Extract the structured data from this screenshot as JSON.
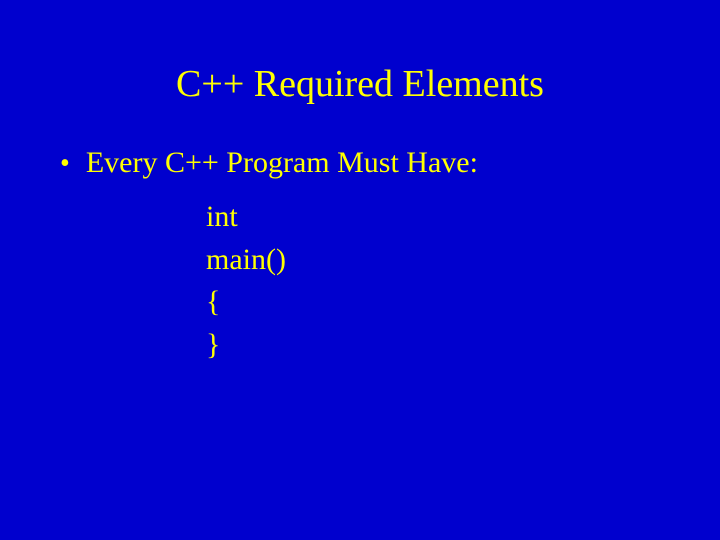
{
  "slide": {
    "title": "C++ Required Elements",
    "bullet": {
      "marker": "•",
      "text": "Every C++ Program Must Have:"
    },
    "code": {
      "line1": "int",
      "line2": "main()",
      "line3": "{",
      "line4": "}"
    }
  },
  "colors": {
    "background": "#0000ce",
    "text": "#ffff00"
  }
}
